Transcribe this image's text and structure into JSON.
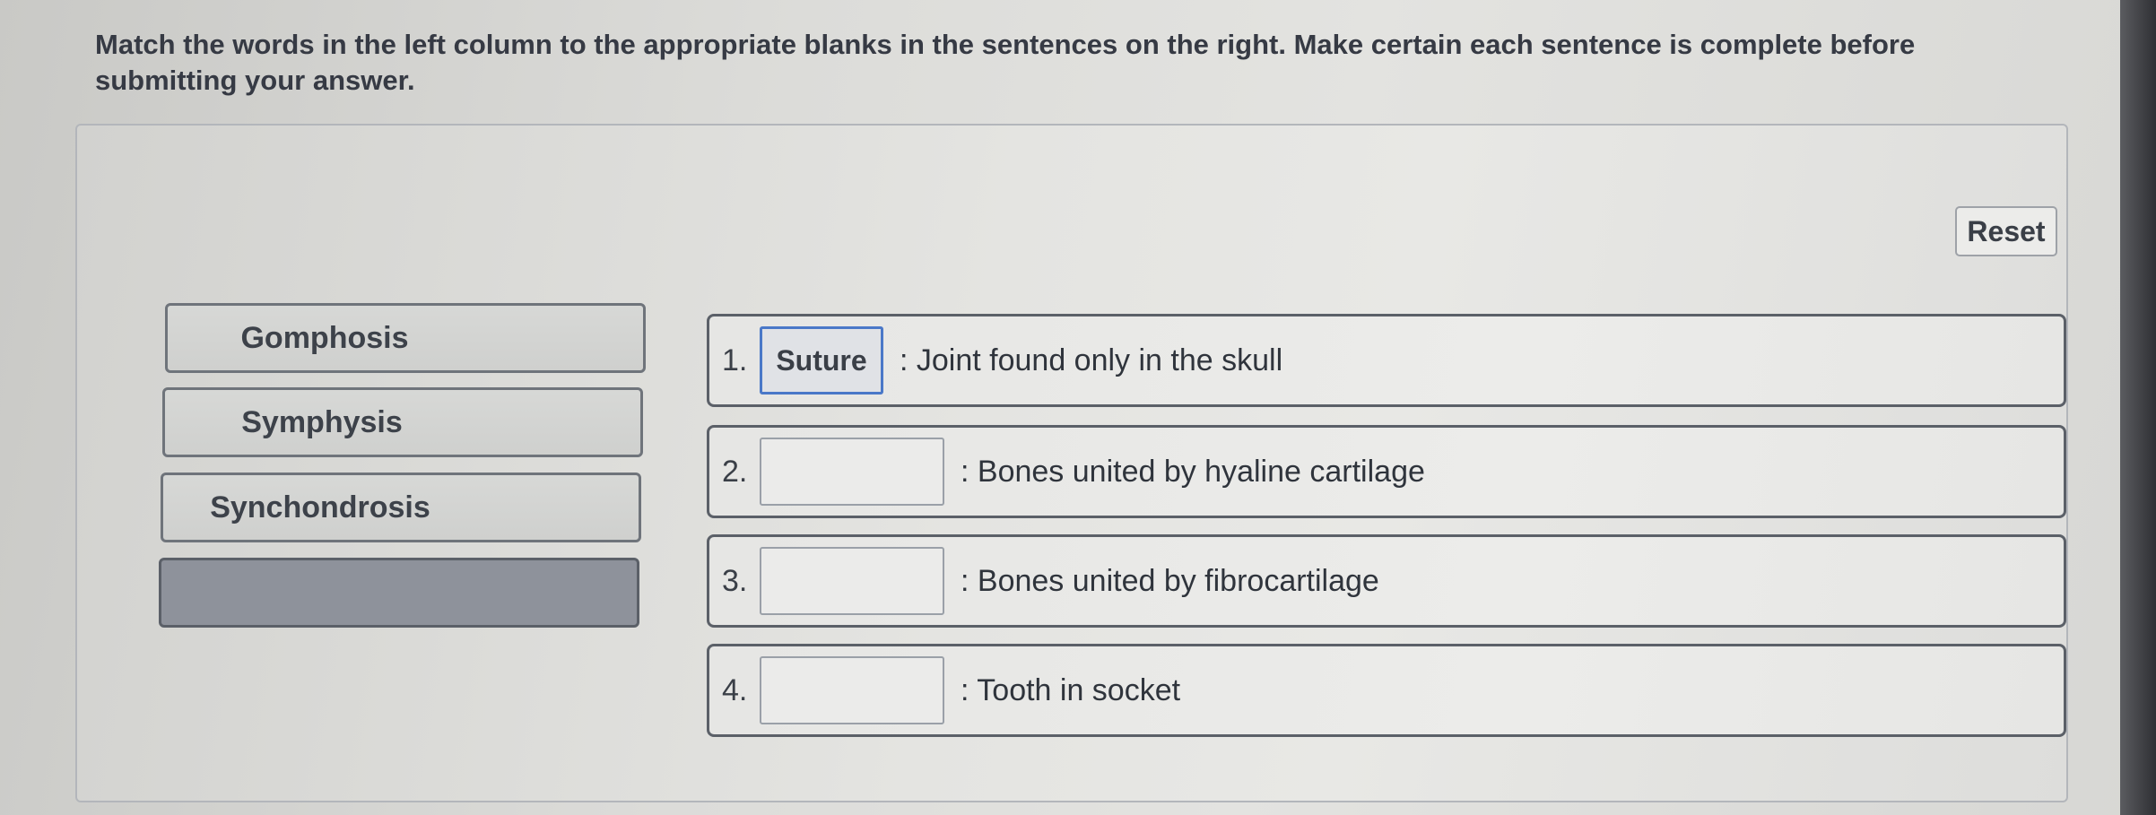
{
  "instructions": "Match the words in the left column to the appropriate blanks in the sentences on the right. Make certain each sentence is complete before submitting your answer.",
  "reset_label": "Reset",
  "word_bank": [
    {
      "label": "Gomphosis"
    },
    {
      "label": "Symphysis"
    },
    {
      "label": "Synchondrosis"
    },
    {
      "label": ""
    }
  ],
  "sentences": [
    {
      "number": "1.",
      "answer": "Suture",
      "text": ": Joint found only in the skull"
    },
    {
      "number": "2.",
      "answer": "",
      "text": ": Bones united by hyaline cartilage"
    },
    {
      "number": "3.",
      "answer": "",
      "text": ": Bones united by fibrocartilage"
    },
    {
      "number": "4.",
      "answer": "",
      "text": ": Tooth in socket"
    }
  ]
}
